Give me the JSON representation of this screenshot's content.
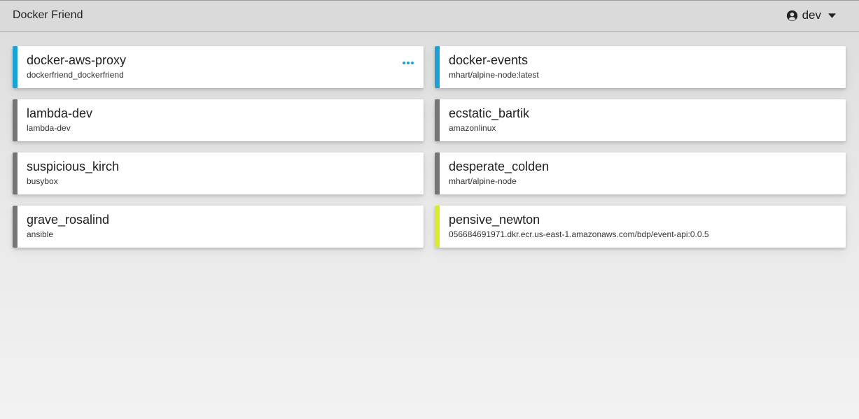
{
  "header": {
    "title": "Docker Friend",
    "user": "dev",
    "user_icon": "user-circle-icon",
    "dropdown_icon": "caret-down-icon"
  },
  "colors": {
    "running": "#1ba2d4",
    "stopped": "#757575",
    "warning": "#d9ec2b"
  },
  "containers": [
    {
      "name": "docker-aws-proxy",
      "image": "dockerfriend_dockerfriend",
      "status": "running",
      "menu": true
    },
    {
      "name": "docker-events",
      "image": "mhart/alpine-node:latest",
      "status": "running",
      "menu": false
    },
    {
      "name": "lambda-dev",
      "image": "lambda-dev",
      "status": "stopped",
      "menu": false
    },
    {
      "name": "ecstatic_bartik",
      "image": "amazonlinux",
      "status": "stopped",
      "menu": false
    },
    {
      "name": "suspicious_kirch",
      "image": "busybox",
      "status": "stopped",
      "menu": false
    },
    {
      "name": "desperate_colden",
      "image": "mhart/alpine-node",
      "status": "stopped",
      "menu": false
    },
    {
      "name": "grave_rosalind",
      "image": "ansible",
      "status": "stopped",
      "menu": false
    },
    {
      "name": "pensive_newton",
      "image": "056684691971.dkr.ecr.us-east-1.amazonaws.com/bdp/event-api:0.0.5",
      "status": "warning",
      "menu": false
    }
  ]
}
